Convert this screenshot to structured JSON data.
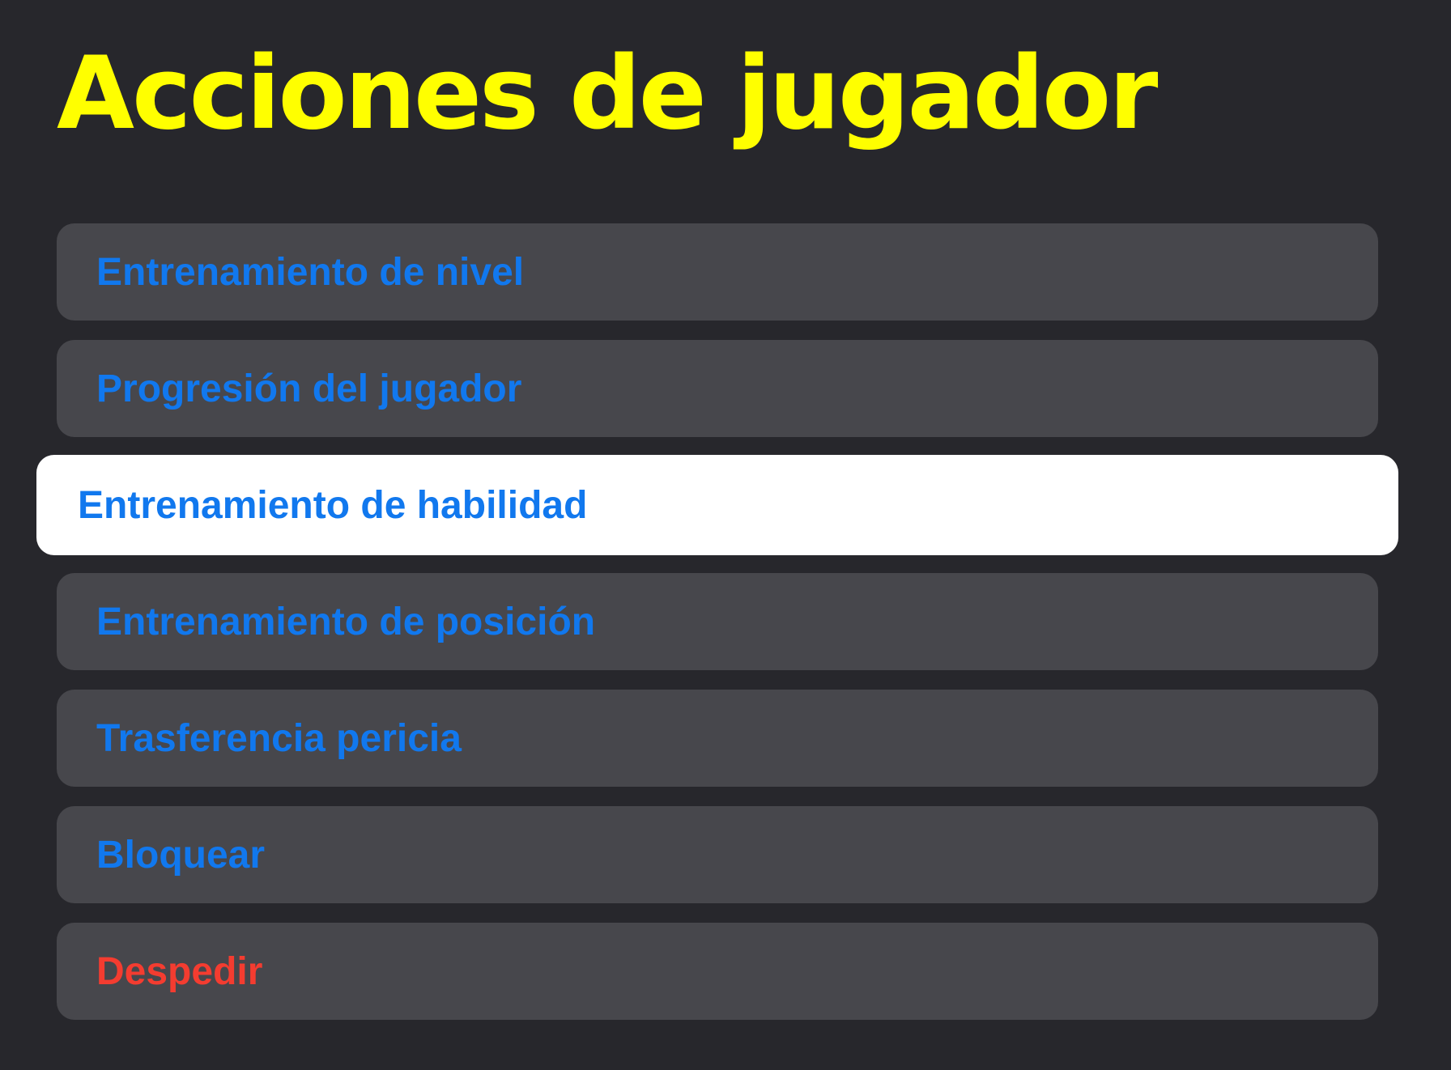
{
  "header": {
    "title": "Acciones de jugador"
  },
  "menu": {
    "selected_index": 2,
    "items": [
      {
        "label": "Entrenamiento de nivel",
        "style": "default"
      },
      {
        "label": "Progresión del jugador",
        "style": "default"
      },
      {
        "label": "Entrenamiento de habilidad",
        "style": "selected"
      },
      {
        "label": "Entrenamiento de posición",
        "style": "default"
      },
      {
        "label": "Trasferencia pericia",
        "style": "default"
      },
      {
        "label": "Bloquear",
        "style": "default"
      },
      {
        "label": "Despedir",
        "style": "destructive"
      }
    ]
  },
  "colors": {
    "background": "#27272c",
    "title": "#ffff00",
    "item_background": "#47474c",
    "selected_background": "#ffffff",
    "item_text": "#1178ee",
    "destructive_text": "#f43c30"
  }
}
